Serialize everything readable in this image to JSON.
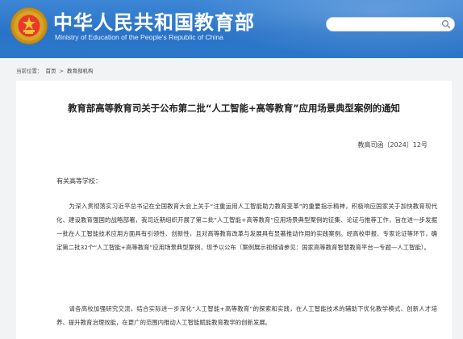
{
  "header": {
    "title": "中华人民共和国教育部",
    "subtitle": "Ministry of Education of the People's Republic of China",
    "search": {
      "value": "",
      "placeholder": ""
    },
    "colors": {
      "header_blue": "#2a74c8",
      "emblem_red": "#e8382b",
      "emblem_gold": "#d9a421"
    }
  },
  "breadcrumb": {
    "prefix": "当前位置：",
    "items": [
      "首页",
      "教育部机构"
    ],
    "separator": ">"
  },
  "article": {
    "title": "教育部高等教育司关于公布第二批“人工智能+高等教育”应用场景典型案例的通知",
    "doc_number": "教高司函〔2024〕12号",
    "salutation": "有关高等学校：",
    "paragraphs": [
      "为深入贯彻落实习近平总书记在全国教育大会上关于“注重运用人工智能助力教育变革”的重要指示精神，积极响应国家关于加快教育现代化、建设教育强国的战略部署，我司近期组织开展了第二批“人工智能+高等教育”应用场景典型案例的征集、论证与推荐工作，旨在进一步发掘一批在人工智能技术应用方面具有引领性、创新性，且对高等教育改革与发展具有显著推动作用的实践案例。经高校申报、专家论证等环节，确定第二批32个“人工智能+高等教育”应用场景典型案例，现予以公布（案例展示视频请参见：国家高等教育智慧教育平台—专题—人工智能）。",
      "请各高校加强研究交流，结合实际进一步深化“人工智能+高等教育”的探索和实践，在人工智能技术的辅助下优化教学模式、创新人才培养、提升教育治理效能，在更广的范围内推动人工智能赋能教育教学的创新发展。"
    ]
  }
}
